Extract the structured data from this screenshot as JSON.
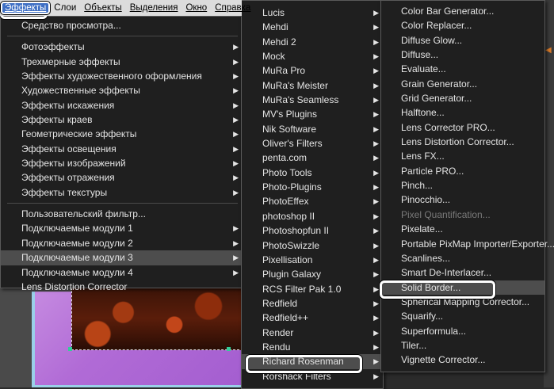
{
  "menubar": {
    "items": [
      "Эффекты",
      "Слои",
      "Объекты",
      "Выделения",
      "Окно",
      "Справка"
    ]
  },
  "effects_menu": {
    "top": [
      "Средство просмотра..."
    ],
    "groups": [
      [
        "Фотоэффекты",
        "Трехмерные эффекты",
        "Эффекты художественного оформления",
        "Художественные эффекты",
        "Эффекты искажения",
        "Эффекты краев",
        "Геометрические эффекты",
        "Эффекты освещения",
        "Эффекты изображений",
        "Эффекты отражения",
        "Эффекты текстуры"
      ],
      [
        "Пользовательский фильтр...",
        "Подключаемые модули 1",
        "Подключаемые модули 2",
        "Подключаемые модули 3",
        "Подключаемые модули 4",
        "Lens Distortion Corrector"
      ]
    ],
    "highlighted": "Подключаемые модули 3"
  },
  "plugins_menu": {
    "items": [
      "Lucis",
      "Mehdi",
      "Mehdi 2",
      "Mock",
      "MuRa Pro",
      "MuRa's Meister",
      "MuRa's Seamless",
      "MV's Plugins",
      "Nik Software",
      "Oliver's Filters",
      "penta.com",
      "Photo Tools",
      "Photo-Plugins",
      "PhotoEffex",
      "photoshop II",
      "Photoshopfun II",
      "PhotoSwizzle",
      "Pixellisation",
      "Plugin Galaxy",
      "RCS Filter Pak 1.0",
      "Redfield",
      "Redfield++",
      "Render",
      "Rendu",
      "Richard Rosenman",
      "Rorshack Filters"
    ],
    "highlighted": "Richard Rosenman"
  },
  "rosenman_menu": {
    "items": [
      "Color Bar Generator...",
      "Color Replacer...",
      "Diffuse Glow...",
      "Diffuse...",
      "Evaluate...",
      "Grain Generator...",
      "Grid Generator...",
      "Halftone...",
      "Lens Corrector PRO...",
      "Lens Distortion Corrector...",
      "Lens FX...",
      "Particle PRO...",
      "Pinch...",
      "Pinocchio...",
      "Pixel Quantification...",
      "Pixelate...",
      "Portable PixMap Importer/Exporter...",
      "Scanlines...",
      "Smart De-Interlacer...",
      "Solid Border...",
      "Spherical Mapping Corrector...",
      "Squarify...",
      "Superformula...",
      "Tiler...",
      "Vignette Corrector..."
    ],
    "disabled": [
      "Pixel Quantification..."
    ],
    "highlighted": "Solid Border..."
  }
}
